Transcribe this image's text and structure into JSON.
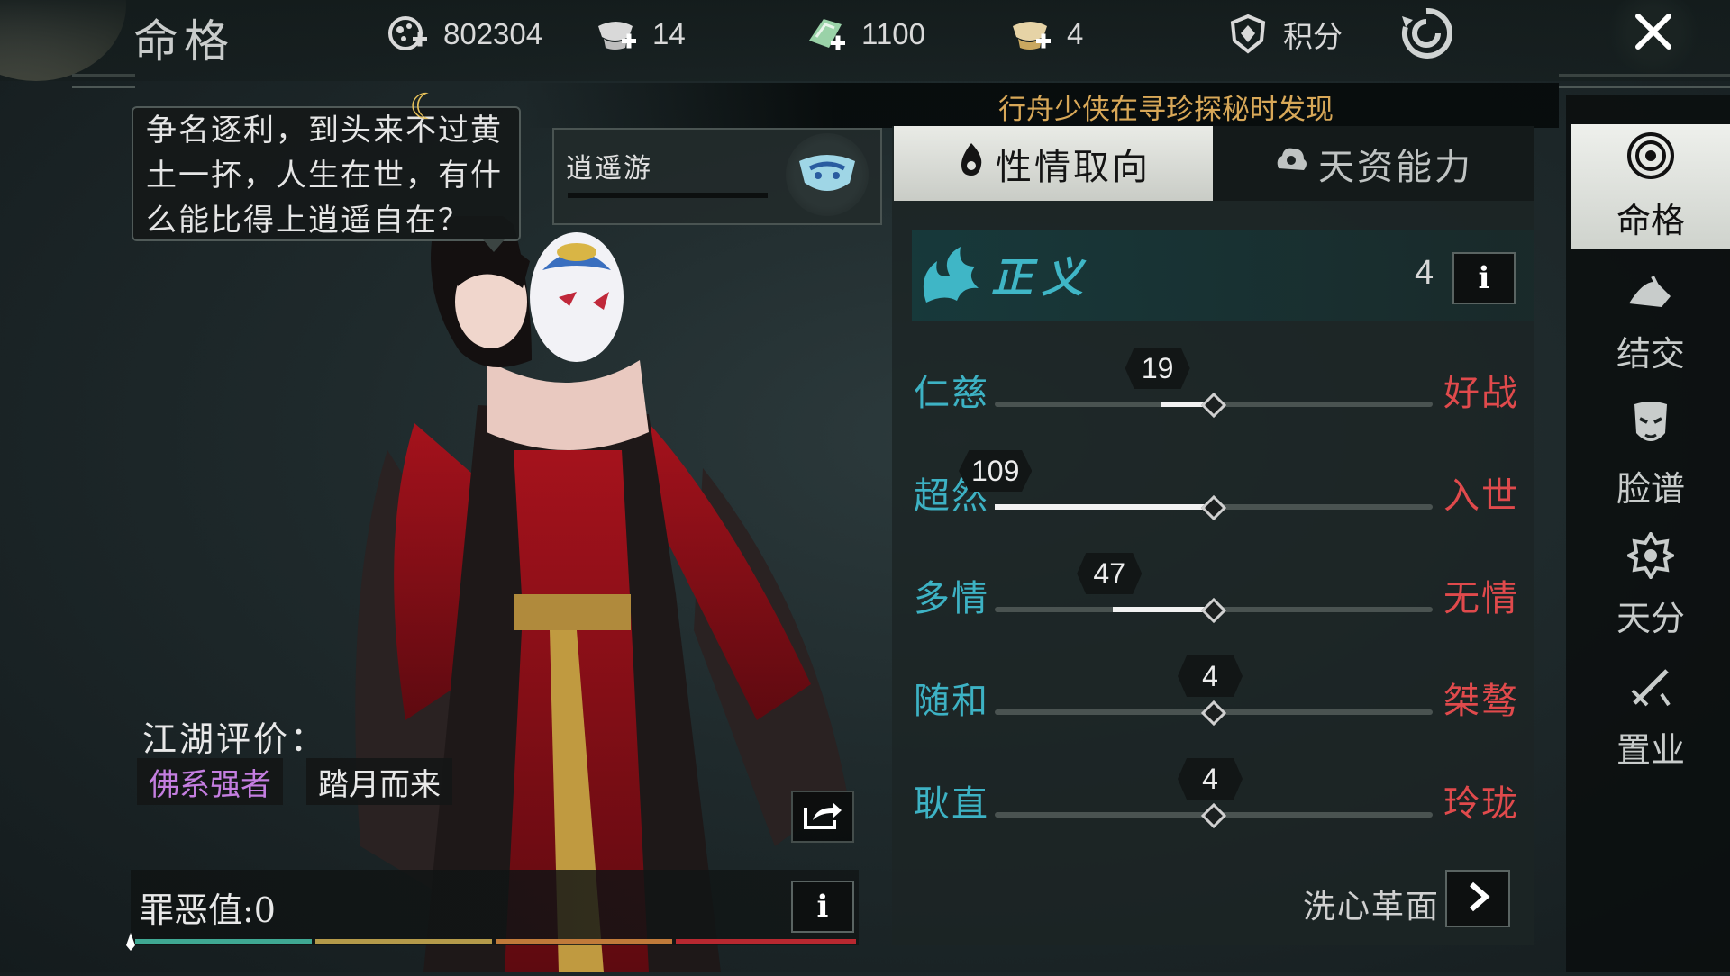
{
  "header": {
    "title": "命格",
    "resources": [
      {
        "icon": "coin-plus-icon",
        "value": "802304"
      },
      {
        "icon": "ingot-plus-icon",
        "value": "14"
      },
      {
        "icon": "jade-plus-icon",
        "value": "1100"
      },
      {
        "icon": "gold-ingot-plus-icon",
        "value": "4"
      }
    ],
    "points_label": "积分",
    "close_icon": "close-icon"
  },
  "notice": {
    "text": "行舟少侠在寻珍探秘时发现"
  },
  "speech": {
    "lines": [
      "争名逐利，到头来不过黄",
      "土一抔，人生在世，有什",
      "么能比得上逍遥自在？"
    ]
  },
  "character_title": {
    "text": "逍遥游"
  },
  "evaluation": {
    "label": "江湖评价：",
    "tags": [
      "佛系强者",
      "踏月而来"
    ],
    "tag_colors": [
      "#c47ee0",
      "#e8e8e8"
    ]
  },
  "sin": {
    "label": "罪恶值:0",
    "value": 0
  },
  "tabs": [
    {
      "label": "性情取向",
      "icon": "flame-icon",
      "active": true
    },
    {
      "label": "天资能力",
      "icon": "cloud-swirl-icon",
      "active": false
    }
  ],
  "trait": {
    "name": "正义",
    "value": "4",
    "icon": "wave-crest-icon"
  },
  "sliders": [
    {
      "left": "仁慈",
      "right": "好战",
      "value": "19",
      "level": 0.38
    },
    {
      "left": "超然",
      "right": "入世",
      "value": "109",
      "level": 0.0
    },
    {
      "left": "多情",
      "right": "无情",
      "value": "47",
      "level": 0.27
    },
    {
      "left": "随和",
      "right": "桀骜",
      "value": "4",
      "level": 0.5
    },
    {
      "left": "耿直",
      "right": "玲珑",
      "value": "4",
      "level": 0.5
    }
  ],
  "reform": {
    "label": "洗心革面"
  },
  "sidenav": [
    {
      "label": "命格",
      "icon": "spiral-emblem-icon",
      "active": true
    },
    {
      "label": "结交",
      "icon": "handshake-icon",
      "active": false
    },
    {
      "label": "脸谱",
      "icon": "opera-mask-icon",
      "active": false
    },
    {
      "label": "天分",
      "icon": "gear-star-icon",
      "active": false
    },
    {
      "label": "置业",
      "icon": "sword-house-icon",
      "active": false
    }
  ],
  "colors": {
    "accent_teal": "#3db2c4",
    "accent_red": "#e04a4c",
    "notice_gold": "#d8a858",
    "tag_purple": "#c47ee0"
  }
}
